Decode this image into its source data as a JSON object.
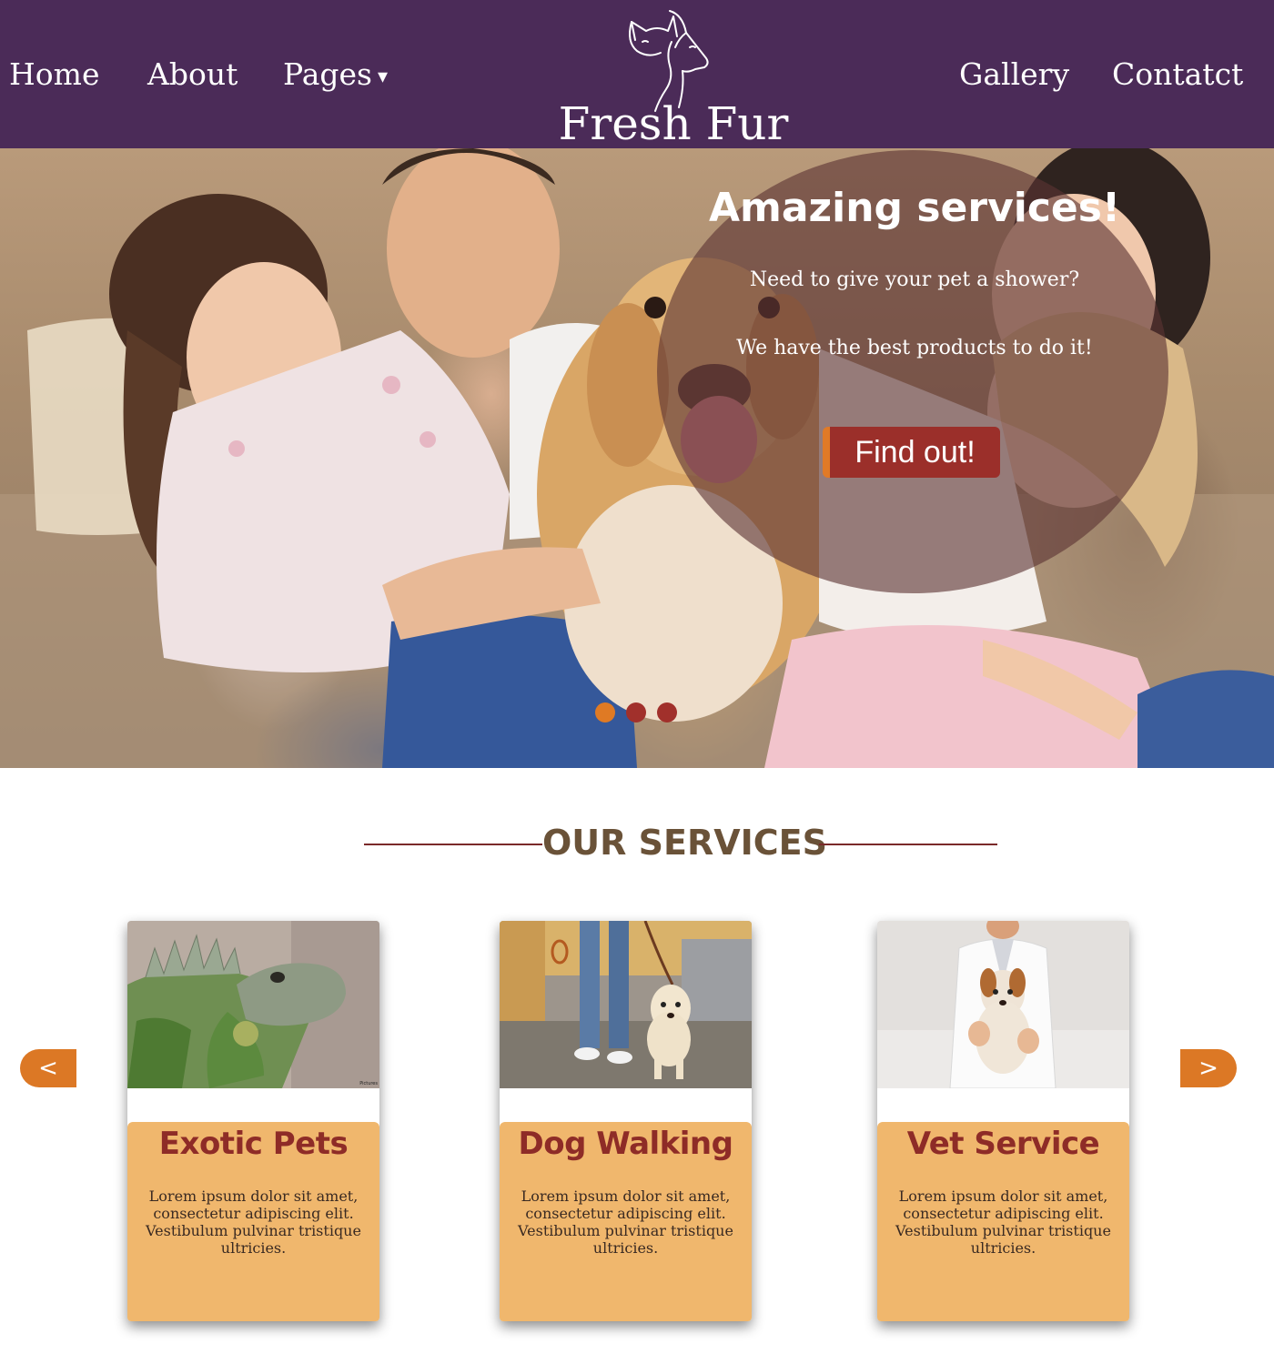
{
  "header": {
    "nav_left": [
      "Home",
      "About",
      "Pages"
    ],
    "pages_caret": "▾",
    "nav_right": [
      "Gallery",
      "Contatct"
    ],
    "logo_text": "Fresh Fur"
  },
  "hero": {
    "title": "Amazing services!",
    "line1": "Need to give your pet a shower?",
    "line2": "We have the best products to do it!",
    "button": "Find out!",
    "slides": 3,
    "active_slide": 1
  },
  "services": {
    "heading": "OUR SERVICES",
    "prev": "<",
    "next": ">",
    "cards": [
      {
        "title": "Exotic Pets",
        "desc": "Lorem ipsum dolor sit amet, consectetur adipiscing elit. Vestibulum pulvinar tristique ultricies.",
        "image": "iguana-photo",
        "credit": "Pictures"
      },
      {
        "title": "Dog Walking",
        "desc": "Lorem ipsum dolor sit amet, consectetur adipiscing elit. Vestibulum pulvinar tristique ultricies.",
        "image": "dog-walking-photo"
      },
      {
        "title": "Vet Service",
        "desc": "Lorem ipsum dolor sit amet, consectetur adipiscing elit. Vestibulum pulvinar tristique ultricies.",
        "image": "vet-holding-dog-photo"
      }
    ]
  },
  "colors": {
    "header_bg": "#4b2b58",
    "accent_orange": "#df7a24",
    "button_red": "#9b2f2a",
    "card_body": "#f0b76d",
    "card_title": "#8e2c27",
    "heading_text": "#6a5238"
  }
}
